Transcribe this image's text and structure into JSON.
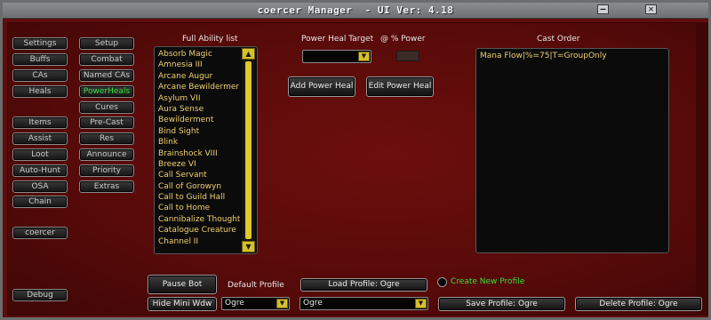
{
  "window": {
    "title": "coercer Manager  - UI Ver: 4.18",
    "minimize_glyph": "—",
    "close_glyph": "✕"
  },
  "nav_left": [
    {
      "label": "Settings"
    },
    {
      "label": "Buffs"
    },
    {
      "label": "CAs"
    },
    {
      "label": "Heals"
    },
    {
      "label": "Items"
    },
    {
      "label": "Assist"
    },
    {
      "label": "Loot"
    },
    {
      "label": "Auto-Hunt"
    },
    {
      "label": "OSA"
    },
    {
      "label": "Chain"
    }
  ],
  "nav_right": [
    {
      "label": "Setup"
    },
    {
      "label": "Combat"
    },
    {
      "label": "Named CAs"
    },
    {
      "label": "PowerHeals",
      "active": true
    },
    {
      "label": "Cures"
    },
    {
      "label": "Pre-Cast"
    },
    {
      "label": "Res"
    },
    {
      "label": "Announce"
    },
    {
      "label": "Priority"
    },
    {
      "label": "Extras"
    }
  ],
  "character_button": "coercer",
  "debug_button": "Debug",
  "ability_list": {
    "title": "Full Ability list",
    "items": [
      "Absorb Magic",
      "Amnesia III",
      "Arcane Augur",
      "Arcane Bewildermer",
      "Asylum VII",
      "Aura Sense",
      "Bewilderment",
      "Bind Sight",
      "Blink",
      "Brainshock VIII",
      "Breeze VI",
      "Call Servant",
      "Call of Gorowyn",
      "Call to Guild Hall",
      "Call to Home",
      "Cannibalize Thought",
      "Catalogue Creature",
      "Channel II"
    ],
    "scroll_up": "▲",
    "scroll_down": "▼"
  },
  "power_heal": {
    "target_label": "Power Heal Target",
    "percent_label": "@ % Power",
    "target_value": "",
    "percent_value": "",
    "add_button": "Add Power Heal",
    "edit_button": "Edit Power Heal"
  },
  "cast_order": {
    "title": "Cast Order",
    "items": [
      "Mana Flow|%=75|T=GroupOnly"
    ]
  },
  "bottom": {
    "pause_button": "Pause Bot",
    "hide_button": "Hide Mini Wdw",
    "default_profile_label": "Default Profile",
    "default_profile_value": "Ogre",
    "load_profile_button": "Load Profile: Ogre",
    "profile_value": "Ogre",
    "create_profile_label": "Create New Profile",
    "save_profile_button": "Save Profile: Ogre",
    "delete_profile_button": "Delete Profile: Ogre"
  },
  "dropdown_arrow": "▼",
  "colors": {
    "window_bg": "#5e0d0b",
    "list_text": "#f0d070",
    "active_nav": "#39e039",
    "create_profile": "#39e039",
    "scroll_yellow": "#d8c02a"
  }
}
